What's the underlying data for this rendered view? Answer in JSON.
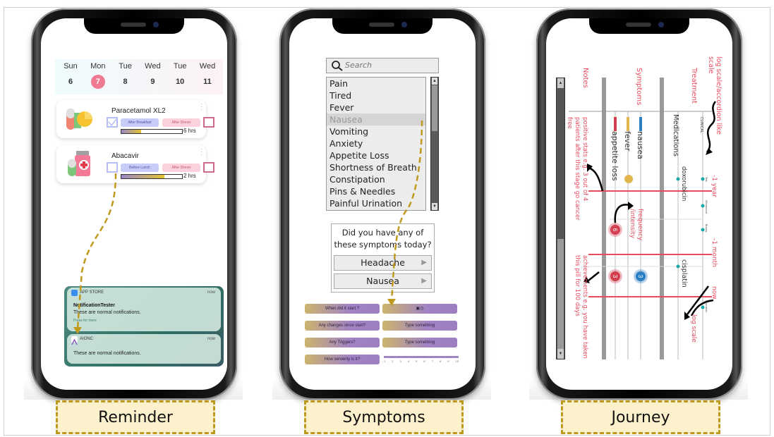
{
  "labels": {
    "reminder": "Reminder",
    "symptoms": "Symptoms",
    "journey": "Journey"
  },
  "colors": {
    "label_bg": "#fdf1cd",
    "label_border": "#c09a1e",
    "arrow": "#c09a1e",
    "accent_pink": "#f07a92",
    "annotation_red": "#e94b5e",
    "purple": "#a083c4"
  },
  "reminder": {
    "days": [
      {
        "name": "Sun",
        "date": "6"
      },
      {
        "name": "Mon",
        "date": "7",
        "active": true
      },
      {
        "name": "Tue",
        "date": "8"
      },
      {
        "name": "Wed",
        "date": "9"
      },
      {
        "name": "Tue",
        "date": "10"
      },
      {
        "name": "Wed",
        "date": "11"
      }
    ],
    "medications": [
      {
        "name": "Paracetamol XL2",
        "icon": "pill-capsule-icon",
        "first_dose": "After Breakfast",
        "second_dose": "After Dinner",
        "first_checked": true,
        "second_checked": false,
        "progress": 0.32,
        "time_left": "6 hrs"
      },
      {
        "name": "Abacavir",
        "icon": "medicine-bottle-icon",
        "first_dose": "Before Lunch",
        "second_dose": "After Dinner",
        "first_checked": false,
        "second_checked": false,
        "progress": 0.71,
        "time_left": "2 hrs"
      }
    ],
    "notifications": [
      {
        "app": "APP STORE",
        "time": "now",
        "title": "NotificationTester",
        "body": "These are normal notifications.",
        "more": "Press for more"
      },
      {
        "app": "AIONC",
        "time": "now",
        "body": "These are normal notifications."
      }
    ]
  },
  "symptoms": {
    "search_placeholder": "Search",
    "list": [
      "Pain",
      "Tired",
      "Fever",
      "Nausea",
      "Vomiting",
      "Anxiety",
      "Appetite Loss",
      "Shortness of Breath",
      "Constipation",
      "Pins & Needles",
      "Painful Urination"
    ],
    "selected": "Nausea",
    "question": "Did you have any of these symptoms today?",
    "answers": [
      "Headache",
      "Nausea"
    ],
    "details": [
      {
        "question": "When did it start ?",
        "answer_icon": "calendar-clock-icon"
      },
      {
        "question": "Any changes since start?",
        "answer": "Type something"
      },
      {
        "question": "Any Triggers?",
        "answer": "Type something"
      },
      {
        "question": "How serverity is it?",
        "scale": [
          "1",
          "2",
          "3",
          "4",
          "5",
          "6",
          "7",
          "8",
          "9",
          "10"
        ]
      }
    ]
  },
  "journey": {
    "headers": [
      "Notes",
      "Symptoms",
      "Treatment",
      "log scale/accordion like scale"
    ],
    "symptom_tracks": [
      "appetite loss",
      "fever",
      "nausea"
    ],
    "symptom_colors": [
      "#d2404f",
      "#e0b64e",
      "#2b7fc2"
    ],
    "treatment_tracks": [
      "Medications",
      "CLINICAL"
    ],
    "medications": [
      "doxorubicin",
      "cisplatin"
    ],
    "clinical_events": [
      "Test",
      "Ultrasound",
      "Biopsy",
      "Operation"
    ],
    "time_markers": [
      "-1 year",
      "-1 month",
      "now"
    ],
    "symptom_badges": [
      {
        "track": "appetite loss",
        "value": "6"
      },
      {
        "track": "appetite loss",
        "value": "3"
      },
      {
        "track": "nausea",
        "value": "3"
      }
    ],
    "notes": [
      "positive stats e.g. 3 out of 4 patients after this stage go cancer free",
      "achievements e.g. you have taken this pill for 100 days"
    ],
    "annotations": [
      "frequency /intensity",
      "log scale"
    ]
  }
}
